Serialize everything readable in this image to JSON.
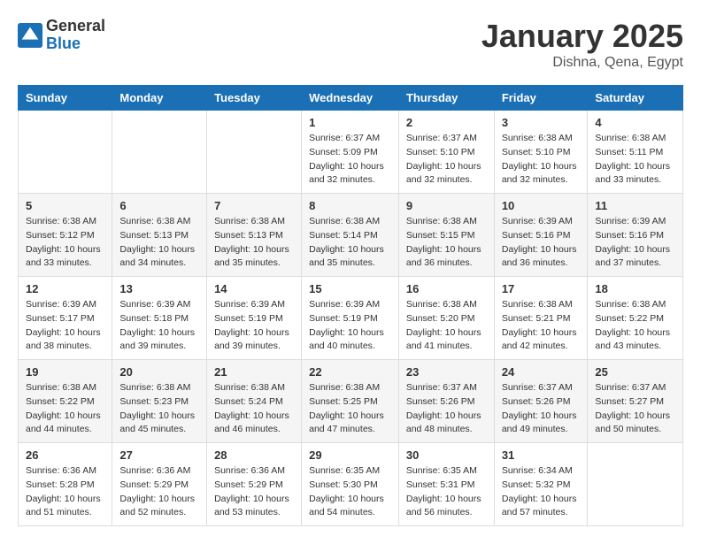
{
  "header": {
    "logo_general": "General",
    "logo_blue": "Blue",
    "month": "January 2025",
    "location": "Dishna, Qena, Egypt"
  },
  "days_of_week": [
    "Sunday",
    "Monday",
    "Tuesday",
    "Wednesday",
    "Thursday",
    "Friday",
    "Saturday"
  ],
  "weeks": [
    [
      {
        "day": "",
        "sunrise": "",
        "sunset": "",
        "daylight": ""
      },
      {
        "day": "",
        "sunrise": "",
        "sunset": "",
        "daylight": ""
      },
      {
        "day": "",
        "sunrise": "",
        "sunset": "",
        "daylight": ""
      },
      {
        "day": "1",
        "sunrise": "6:37 AM",
        "sunset": "5:09 PM",
        "daylight": "10 hours and 32 minutes."
      },
      {
        "day": "2",
        "sunrise": "6:37 AM",
        "sunset": "5:10 PM",
        "daylight": "10 hours and 32 minutes."
      },
      {
        "day": "3",
        "sunrise": "6:38 AM",
        "sunset": "5:10 PM",
        "daylight": "10 hours and 32 minutes."
      },
      {
        "day": "4",
        "sunrise": "6:38 AM",
        "sunset": "5:11 PM",
        "daylight": "10 hours and 33 minutes."
      }
    ],
    [
      {
        "day": "5",
        "sunrise": "6:38 AM",
        "sunset": "5:12 PM",
        "daylight": "10 hours and 33 minutes."
      },
      {
        "day": "6",
        "sunrise": "6:38 AM",
        "sunset": "5:13 PM",
        "daylight": "10 hours and 34 minutes."
      },
      {
        "day": "7",
        "sunrise": "6:38 AM",
        "sunset": "5:13 PM",
        "daylight": "10 hours and 35 minutes."
      },
      {
        "day": "8",
        "sunrise": "6:38 AM",
        "sunset": "5:14 PM",
        "daylight": "10 hours and 35 minutes."
      },
      {
        "day": "9",
        "sunrise": "6:38 AM",
        "sunset": "5:15 PM",
        "daylight": "10 hours and 36 minutes."
      },
      {
        "day": "10",
        "sunrise": "6:39 AM",
        "sunset": "5:16 PM",
        "daylight": "10 hours and 36 minutes."
      },
      {
        "day": "11",
        "sunrise": "6:39 AM",
        "sunset": "5:16 PM",
        "daylight": "10 hours and 37 minutes."
      }
    ],
    [
      {
        "day": "12",
        "sunrise": "6:39 AM",
        "sunset": "5:17 PM",
        "daylight": "10 hours and 38 minutes."
      },
      {
        "day": "13",
        "sunrise": "6:39 AM",
        "sunset": "5:18 PM",
        "daylight": "10 hours and 39 minutes."
      },
      {
        "day": "14",
        "sunrise": "6:39 AM",
        "sunset": "5:19 PM",
        "daylight": "10 hours and 39 minutes."
      },
      {
        "day": "15",
        "sunrise": "6:39 AM",
        "sunset": "5:19 PM",
        "daylight": "10 hours and 40 minutes."
      },
      {
        "day": "16",
        "sunrise": "6:38 AM",
        "sunset": "5:20 PM",
        "daylight": "10 hours and 41 minutes."
      },
      {
        "day": "17",
        "sunrise": "6:38 AM",
        "sunset": "5:21 PM",
        "daylight": "10 hours and 42 minutes."
      },
      {
        "day": "18",
        "sunrise": "6:38 AM",
        "sunset": "5:22 PM",
        "daylight": "10 hours and 43 minutes."
      }
    ],
    [
      {
        "day": "19",
        "sunrise": "6:38 AM",
        "sunset": "5:22 PM",
        "daylight": "10 hours and 44 minutes."
      },
      {
        "day": "20",
        "sunrise": "6:38 AM",
        "sunset": "5:23 PM",
        "daylight": "10 hours and 45 minutes."
      },
      {
        "day": "21",
        "sunrise": "6:38 AM",
        "sunset": "5:24 PM",
        "daylight": "10 hours and 46 minutes."
      },
      {
        "day": "22",
        "sunrise": "6:38 AM",
        "sunset": "5:25 PM",
        "daylight": "10 hours and 47 minutes."
      },
      {
        "day": "23",
        "sunrise": "6:37 AM",
        "sunset": "5:26 PM",
        "daylight": "10 hours and 48 minutes."
      },
      {
        "day": "24",
        "sunrise": "6:37 AM",
        "sunset": "5:26 PM",
        "daylight": "10 hours and 49 minutes."
      },
      {
        "day": "25",
        "sunrise": "6:37 AM",
        "sunset": "5:27 PM",
        "daylight": "10 hours and 50 minutes."
      }
    ],
    [
      {
        "day": "26",
        "sunrise": "6:36 AM",
        "sunset": "5:28 PM",
        "daylight": "10 hours and 51 minutes."
      },
      {
        "day": "27",
        "sunrise": "6:36 AM",
        "sunset": "5:29 PM",
        "daylight": "10 hours and 52 minutes."
      },
      {
        "day": "28",
        "sunrise": "6:36 AM",
        "sunset": "5:29 PM",
        "daylight": "10 hours and 53 minutes."
      },
      {
        "day": "29",
        "sunrise": "6:35 AM",
        "sunset": "5:30 PM",
        "daylight": "10 hours and 54 minutes."
      },
      {
        "day": "30",
        "sunrise": "6:35 AM",
        "sunset": "5:31 PM",
        "daylight": "10 hours and 56 minutes."
      },
      {
        "day": "31",
        "sunrise": "6:34 AM",
        "sunset": "5:32 PM",
        "daylight": "10 hours and 57 minutes."
      },
      {
        "day": "",
        "sunrise": "",
        "sunset": "",
        "daylight": ""
      }
    ]
  ]
}
